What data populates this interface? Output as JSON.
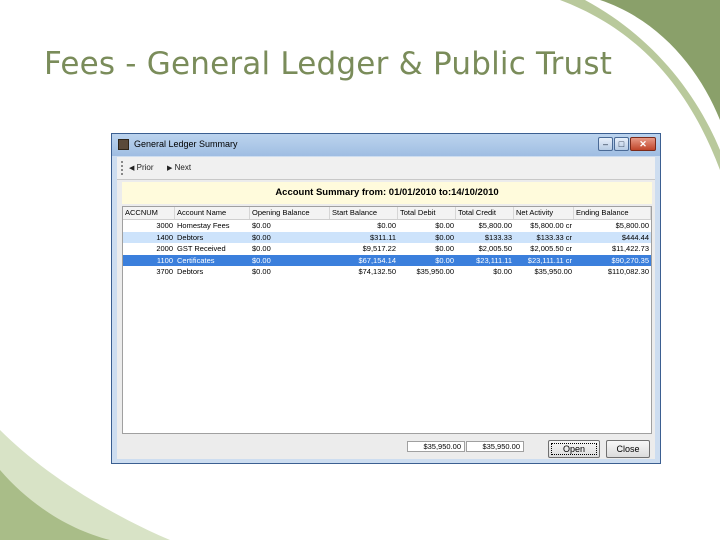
{
  "slide": {
    "title": "Fees - General Ledger & Public Trust"
  },
  "window": {
    "title": "General Ledger Summary",
    "controls": {
      "minimize": "–",
      "maximize": "□",
      "close": "✕"
    }
  },
  "toolbar": {
    "prior": "Prior",
    "next": "Next"
  },
  "summary": {
    "text": "Account Summary from: 01/01/2010 to:14/10/2010"
  },
  "grid": {
    "headers": [
      "ACCNUM",
      "Account Name",
      "Opening Balance",
      "Start Balance",
      "Total Debit",
      "Total Credit",
      "Net Activity",
      "Ending Balance"
    ],
    "rows": [
      {
        "cells": [
          "3000",
          "Homestay Fees",
          "$0.00",
          "$0.00",
          "$0.00",
          "$5,800.00",
          "$5,800.00 cr",
          "$5,800.00"
        ],
        "state": "normal"
      },
      {
        "cells": [
          "1400",
          "Debtors",
          "$0.00",
          "$311.11",
          "$0.00",
          "$133.33",
          "$133.33 cr",
          "$444.44"
        ],
        "state": "selected-light"
      },
      {
        "cells": [
          "2000",
          "GST Received",
          "$0.00",
          "$9,517.22",
          "$0.00",
          "$2,005.50",
          "$2,005.50 cr",
          "$11,422.73"
        ],
        "state": "normal"
      },
      {
        "cells": [
          "1100",
          "Certificates",
          "$0.00",
          "$67,154.14",
          "$0.00",
          "$23,111.11",
          "$23,111.11 cr",
          "$90,270.35"
        ],
        "state": "selected-dark"
      },
      {
        "cells": [
          "3700",
          "Debtors",
          "$0.00",
          "$74,132.50",
          "$35,950.00",
          "$0.00",
          "$35,950.00",
          "$110,082.30"
        ],
        "state": "normal"
      }
    ]
  },
  "totals": {
    "debit": "$35,950.00",
    "credit": "$35,950.00"
  },
  "buttons": {
    "open": "Open",
    "close": "Close"
  },
  "colors": {
    "title": "#7a8c5a",
    "accent_green": "#8aa06a",
    "selection": "#3b7fdc",
    "summary_bg": "#fffbdc"
  }
}
